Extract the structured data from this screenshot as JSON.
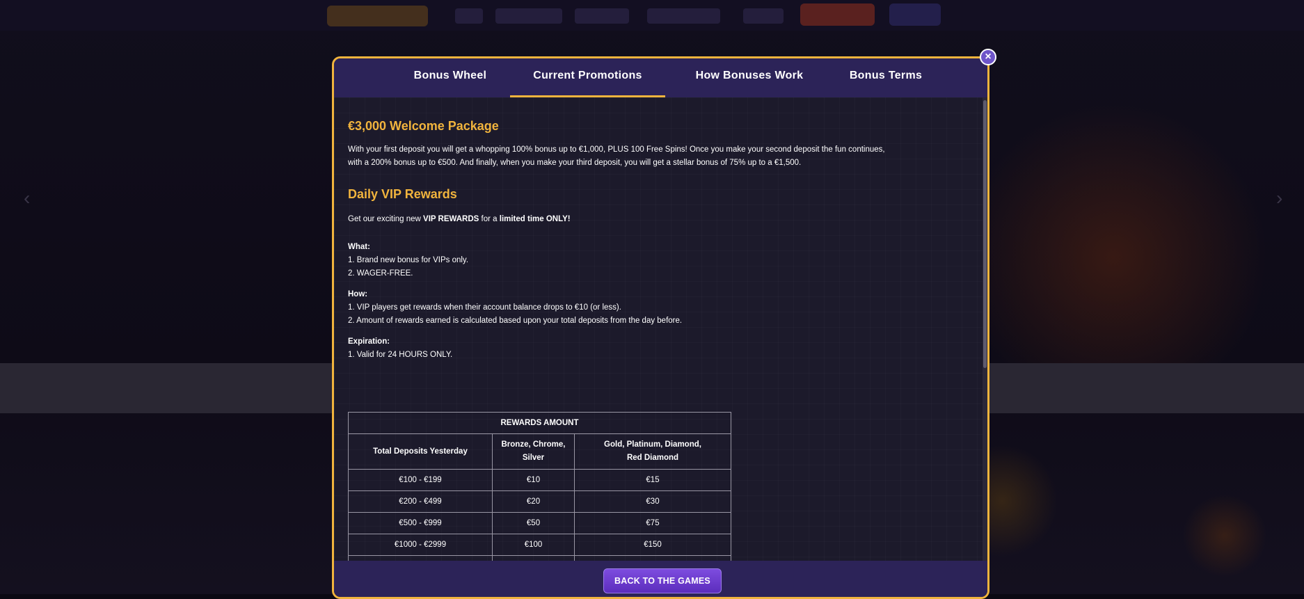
{
  "tabs": [
    {
      "label": "Bonus Wheel"
    },
    {
      "label": "Current Promotions"
    },
    {
      "label": "How Bonuses Work"
    },
    {
      "label": "Bonus Terms"
    }
  ],
  "welcome": {
    "title": "€3,000 Welcome Package",
    "line1": "With your first deposit you will get a whopping 100% bonus up to €1,000, PLUS 100 Free Spins! Once you make your second deposit the fun continues,",
    "line2": "with a 200% bonus up to €500. And finally, when you make your third deposit, you will get a stellar bonus of 75% up to a €1,500."
  },
  "vip": {
    "title": "Daily VIP Rewards",
    "intro_prefix": "Get our exciting new ",
    "intro_bold1": "VIP REWARDS",
    "intro_mid": " for a ",
    "intro_bold2": "limited time ONLY!",
    "what_label": "What:",
    "what_items": [
      "1. Brand new bonus for VIPs only.",
      "2. WAGER-FREE."
    ],
    "how_label": "How:",
    "how_items": [
      "1. VIP players get rewards when their account balance drops to €10 (or less).",
      "2. Amount of rewards earned is calculated based upon your total deposits from the day before."
    ],
    "expiration_label": "Expiration:",
    "expiration_items": [
      "1. Valid for 24 HOURS ONLY."
    ]
  },
  "rewards_table": {
    "header": "REWARDS AMOUNT",
    "col1": "Total Deposits Yesterday",
    "col2_line1": "Bronze, Chrome,",
    "col2_line2": "Silver",
    "col3_line1": "Gold, Platinum, Diamond,",
    "col3_line2": "Red Diamond",
    "rows": [
      [
        "€100 - €199",
        "€10",
        "€15"
      ],
      [
        "€200 - €499",
        "€20",
        "€30"
      ],
      [
        "€500 - €999",
        "€50",
        "€75"
      ],
      [
        "€1000 - €2999",
        "€100",
        "€150"
      ],
      [
        "",
        "",
        ""
      ]
    ]
  },
  "footer": {
    "back_label": "BACK TO THE GAMES"
  },
  "close_symbol": "×",
  "nav_arrows": {
    "left": "‹",
    "right": "›"
  },
  "colors": {
    "accent_gold": "#f1b43d",
    "header_purple": "#2c2358",
    "button_purple": "#6b3fd3"
  }
}
